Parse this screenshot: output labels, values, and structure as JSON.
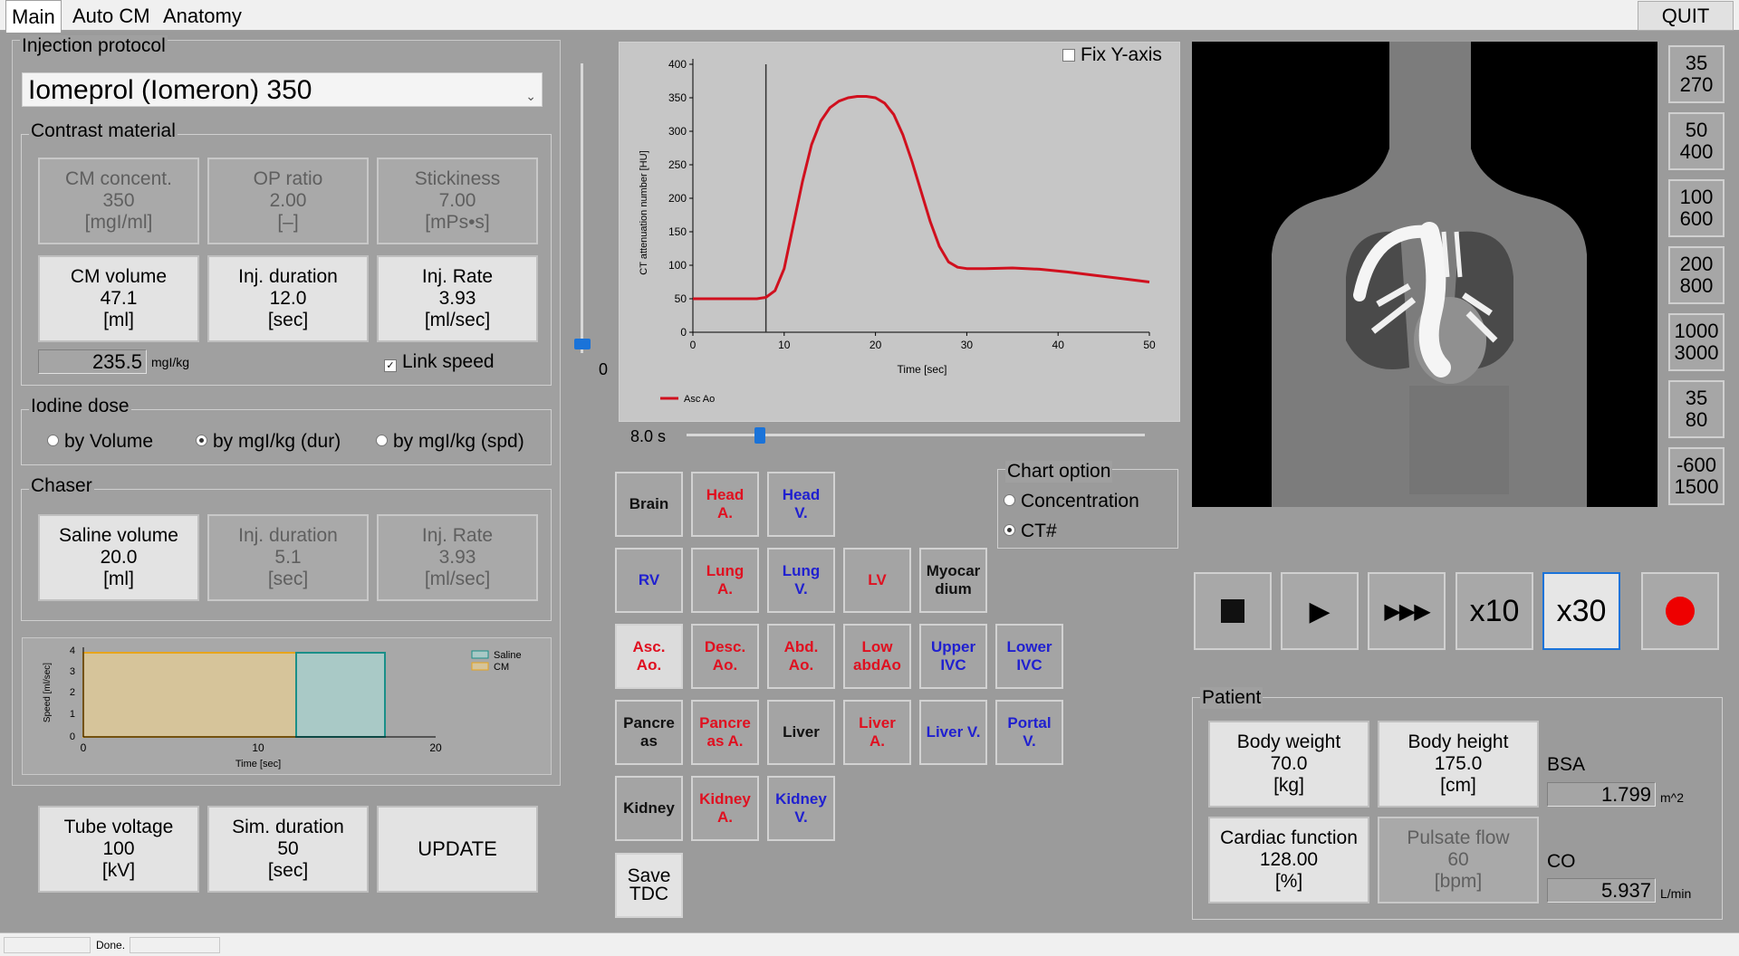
{
  "tabs": [
    "Main",
    "Auto CM",
    "Anatomy"
  ],
  "quit_label": "QUIT",
  "injection": {
    "title": "Injection protocol",
    "agent": "Iomeprol (Iomeron) 350",
    "contrast": {
      "title": "Contrast material",
      "cm_concent": {
        "label": "CM concent.",
        "value": "350",
        "unit": "[mgI/ml]"
      },
      "op_ratio": {
        "label": "OP ratio",
        "value": "2.00",
        "unit": "[–]"
      },
      "stickiness": {
        "label": "Stickiness",
        "value": "7.00",
        "unit": "[mPs•s]"
      },
      "cm_volume": {
        "label": "CM volume",
        "value": "47.1",
        "unit": "[ml]"
      },
      "inj_duration": {
        "label": "Inj. duration",
        "value": "12.0",
        "unit": "[sec]"
      },
      "inj_rate": {
        "label": "Inj. Rate",
        "value": "3.93",
        "unit": "[ml/sec]"
      },
      "dose_value": "235.5",
      "dose_unit": "mgI/kg",
      "link_speed": "Link speed"
    },
    "iodine": {
      "title": "Iodine dose",
      "opt1": "by Volume",
      "opt2": "by mgI/kg (dur)",
      "opt3": "by mgI/kg (spd)"
    },
    "chaser": {
      "title": "Chaser",
      "saline_volume": {
        "label": "Saline volume",
        "value": "20.0",
        "unit": "[ml]"
      },
      "inj_duration": {
        "label": "Inj. duration",
        "value": "5.1",
        "unit": "[sec]"
      },
      "inj_rate": {
        "label": "Inj. Rate",
        "value": "3.93",
        "unit": "[ml/sec]"
      }
    }
  },
  "injection_chart": {
    "ylabel": "Speed [ml/sec]",
    "xlabel": "Time [sec]",
    "legend_saline": "Saline",
    "legend_cm": "CM",
    "yticks": [
      "4",
      "3",
      "2",
      "1",
      "0"
    ],
    "xticks": [
      "0",
      "10",
      "20"
    ]
  },
  "bottom_buttons": {
    "tube_voltage": {
      "label": "Tube voltage",
      "value": "100",
      "unit": "[kV]"
    },
    "sim_duration": {
      "label": "Sim. duration",
      "value": "50",
      "unit": "[sec]"
    },
    "update": "UPDATE"
  },
  "vslider_value": "0",
  "chart_data": {
    "type": "line",
    "title": "",
    "xlabel": "Time [sec]",
    "ylabel": "CT attenuation number [HU]",
    "xlim": [
      0,
      50
    ],
    "ylim": [
      0,
      400
    ],
    "xticks": [
      "0",
      "10",
      "20",
      "30",
      "40",
      "50"
    ],
    "yticks": [
      "400",
      "350",
      "300",
      "250",
      "200",
      "150",
      "100",
      "50",
      "0"
    ],
    "series": [
      {
        "name": "Asc Ao",
        "x": [
          0,
          5,
          7,
          8,
          9,
          10,
          11,
          12,
          13,
          14,
          15,
          16,
          17,
          18,
          19,
          20,
          21,
          22,
          23,
          24,
          25,
          26,
          27,
          28,
          29,
          30,
          32,
          35,
          38,
          41,
          44,
          47,
          50
        ],
        "y": [
          50,
          50,
          50,
          52,
          62,
          95,
          160,
          225,
          280,
          315,
          335,
          345,
          350,
          352,
          352,
          350,
          342,
          325,
          295,
          255,
          210,
          165,
          128,
          105,
          97,
          95,
          95,
          96,
          94,
          90,
          85,
          80,
          75
        ]
      }
    ],
    "marker_x": 8.0
  },
  "fix_y_axis": "Fix Y-axis",
  "time_slider_label": "8.0 s",
  "time_slider_fraction": 0.16,
  "chart_option": {
    "title": "Chart option",
    "opt1": "Concentration",
    "opt2": "CT#"
  },
  "vessels": [
    {
      "label": "Brain",
      "color": "#111111"
    },
    {
      "label": "Head A.",
      "color": "#e01020"
    },
    {
      "label": "Head V.",
      "color": "#2020d0"
    },
    {
      "label": "RV",
      "color": "#2020d0"
    },
    {
      "label": "Lung A.",
      "color": "#e01020"
    },
    {
      "label": "Lung V.",
      "color": "#2020d0"
    },
    {
      "label": "LV",
      "color": "#e01020"
    },
    {
      "label": "Myocar dium",
      "color": "#111111"
    },
    {
      "label": "Asc. Ao.",
      "color": "#e01020"
    },
    {
      "label": "Desc. Ao.",
      "color": "#e01020"
    },
    {
      "label": "Abd. Ao.",
      "color": "#e01020"
    },
    {
      "label": "Low abdAo",
      "color": "#e01020"
    },
    {
      "label": "Upper IVC",
      "color": "#2020d0"
    },
    {
      "label": "Lower IVC",
      "color": "#2020d0"
    },
    {
      "label": "Pancre as",
      "color": "#111111"
    },
    {
      "label": "Pancre as A.",
      "color": "#e01020"
    },
    {
      "label": "Liver",
      "color": "#111111"
    },
    {
      "label": "Liver A.",
      "color": "#e01020"
    },
    {
      "label": "Liver V.",
      "color": "#2020d0"
    },
    {
      "label": "Portal V.",
      "color": "#2020d0"
    },
    {
      "label": "Kidney",
      "color": "#111111"
    },
    {
      "label": "Kidney A.",
      "color": "#e01020"
    },
    {
      "label": "Kidney V.",
      "color": "#2020d0"
    }
  ],
  "save_tdc": "Save TDC",
  "playback": {
    "x10": "x10",
    "x30": "x30"
  },
  "window_presets": [
    {
      "top": "35",
      "bottom": "270"
    },
    {
      "top": "50",
      "bottom": "400"
    },
    {
      "top": "100",
      "bottom": "600"
    },
    {
      "top": "200",
      "bottom": "800"
    },
    {
      "top": "1000",
      "bottom": "3000"
    },
    {
      "top": "35",
      "bottom": "80"
    },
    {
      "top": "-600",
      "bottom": "1500"
    }
  ],
  "patient": {
    "title": "Patient",
    "body_weight": {
      "label": "Body weight",
      "value": "70.0",
      "unit": "[kg]"
    },
    "body_height": {
      "label": "Body height",
      "value": "175.0",
      "unit": "[cm]"
    },
    "cardiac": {
      "label": "Cardiac function",
      "value": "128.00",
      "unit": "[%]"
    },
    "pulsate": {
      "label": "Pulsate flow",
      "value": "60",
      "unit": "[bpm]"
    },
    "bsa_label": "BSA",
    "bsa_value": "1.799",
    "bsa_unit": "m^2",
    "co_label": "CO",
    "co_value": "5.937",
    "co_unit": "L/min"
  },
  "status": {
    "text": "Done."
  }
}
